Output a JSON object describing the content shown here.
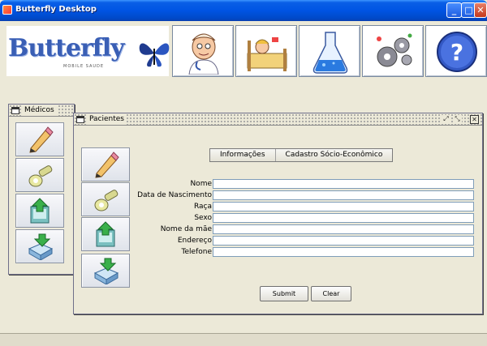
{
  "window": {
    "title": "Butterfly Desktop",
    "controls": [
      "minimize",
      "maximize",
      "close"
    ]
  },
  "banner": {
    "logo": {
      "text": "Butterfly",
      "subtitle": "MOBILE SAUDE"
    },
    "toolbar": [
      {
        "icon": "doctor-icon"
      },
      {
        "icon": "patient-icon"
      },
      {
        "icon": "flask-icon"
      },
      {
        "icon": "gears-icon"
      },
      {
        "icon": "help-icon"
      }
    ]
  },
  "medicos_frame": {
    "title": "Médicos",
    "buttons": [
      "edit-icon",
      "key-icon",
      "export-icon",
      "import-icon"
    ]
  },
  "pacientes_frame": {
    "title": "Pacientes",
    "buttons": [
      "edit-icon",
      "key-icon",
      "export-icon",
      "import-icon"
    ],
    "tabs": [
      {
        "label": "Informações"
      },
      {
        "label": "Cadastro Sócio-Econômico"
      }
    ],
    "fields": [
      {
        "label": "Nome",
        "value": ""
      },
      {
        "label": "Data de Nascimento",
        "value": ""
      },
      {
        "label": "Raça",
        "value": ""
      },
      {
        "label": "Sexo",
        "value": ""
      },
      {
        "label": "Nome da mãe",
        "value": ""
      },
      {
        "label": "Endereço",
        "value": ""
      },
      {
        "label": "Telefone",
        "value": ""
      }
    ],
    "actions": {
      "submit": "Submit",
      "clear": "Clear"
    }
  }
}
